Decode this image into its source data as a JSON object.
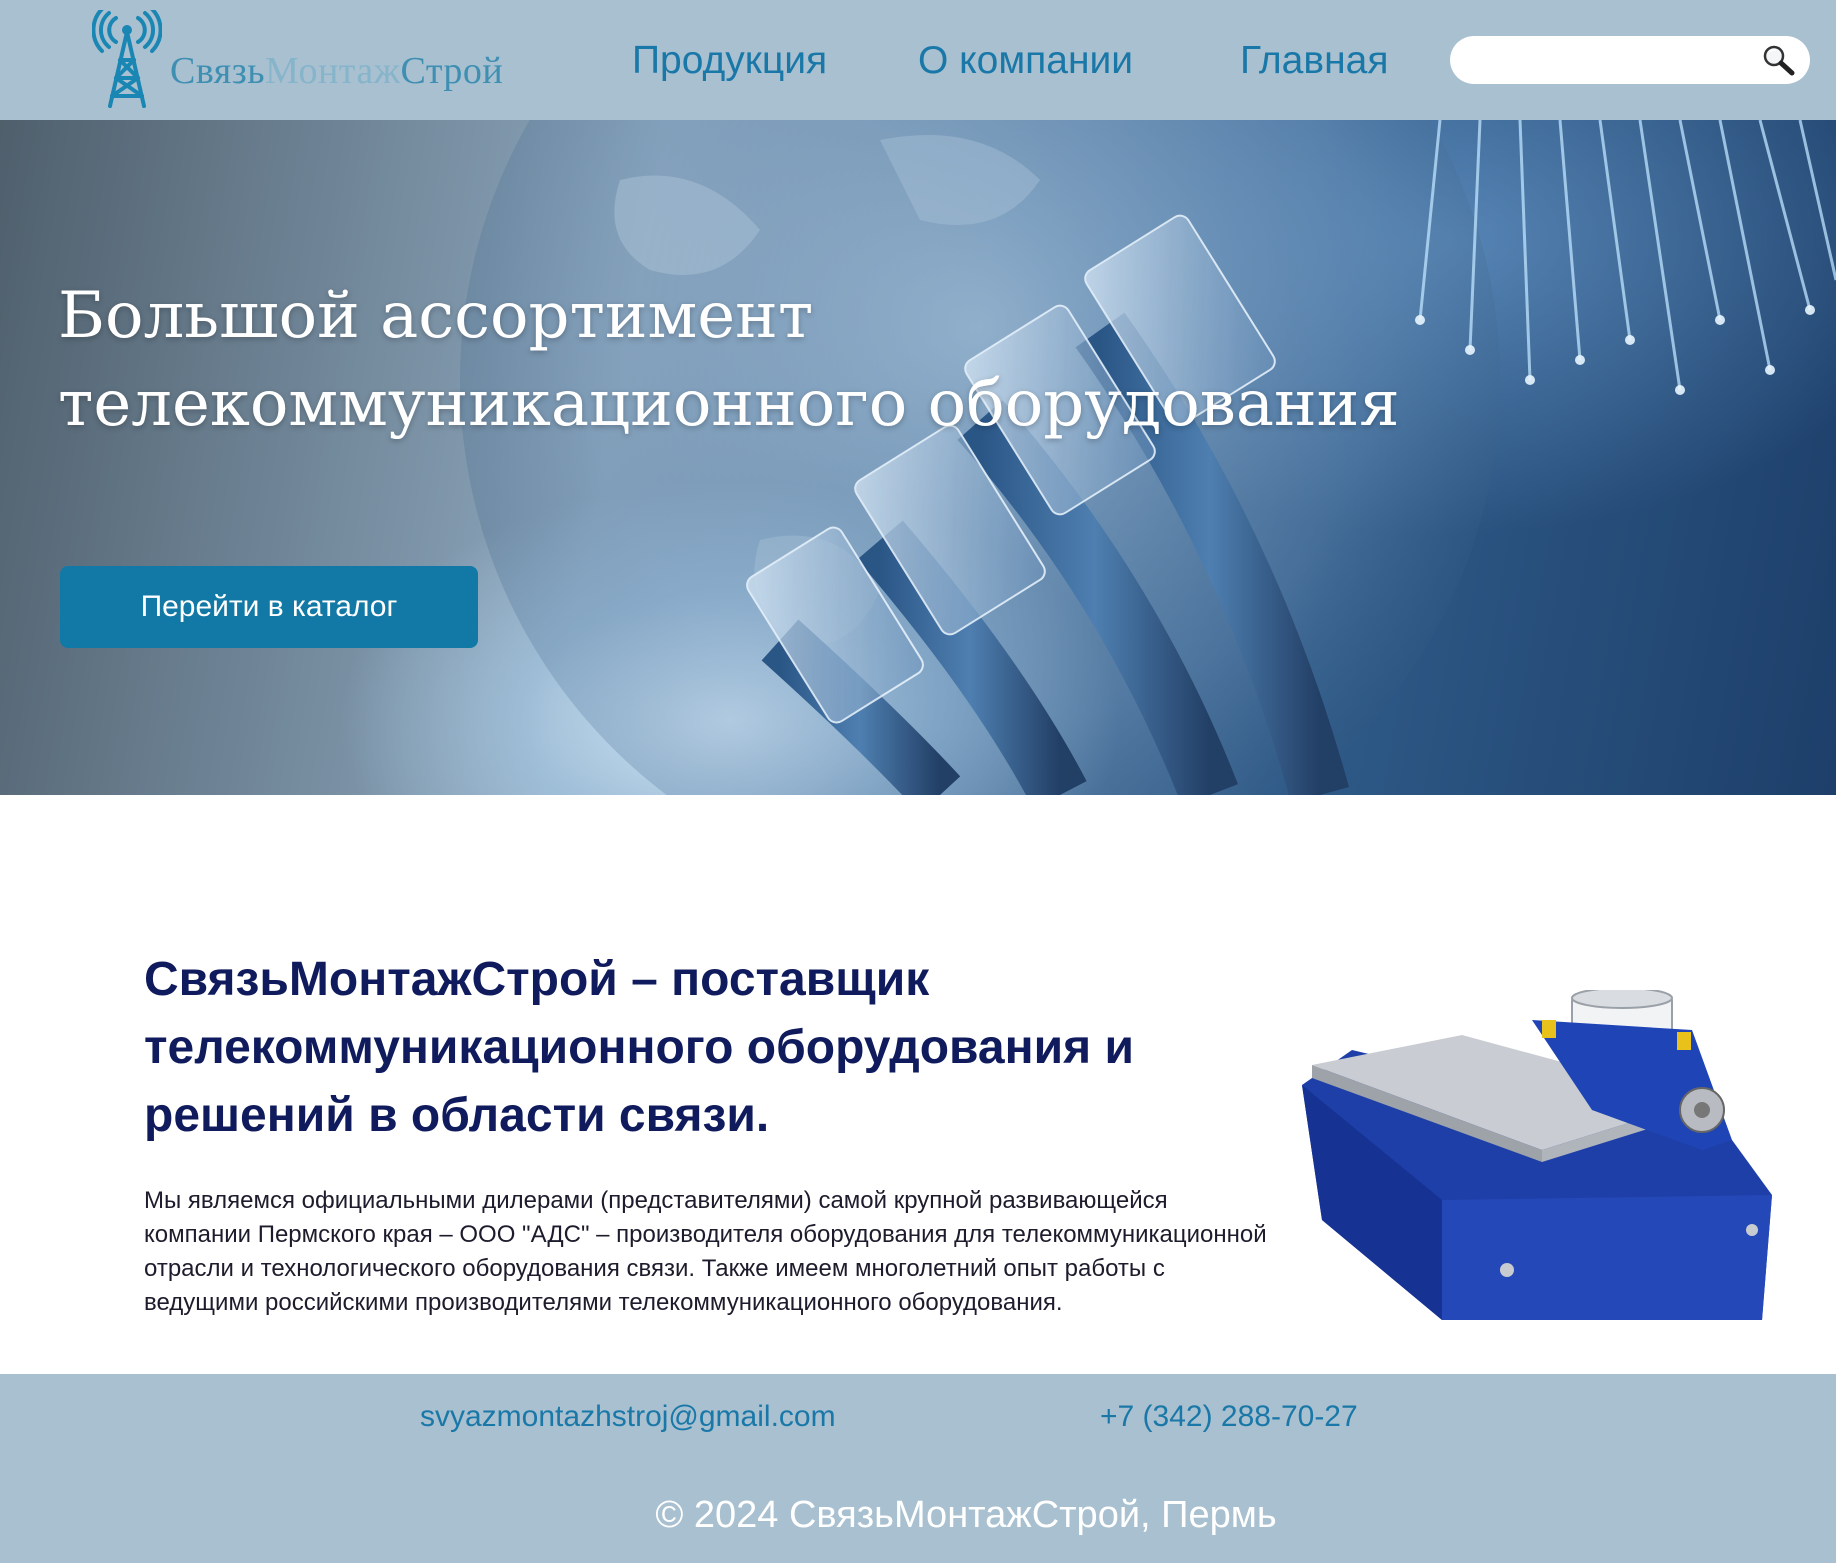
{
  "header": {
    "logo": {
      "part1": "Связь",
      "part2": "Монтаж",
      "part3": "Строй",
      "icon": "radio-tower-icon"
    },
    "nav": [
      {
        "label": "Продукция"
      },
      {
        "label": "О компании"
      },
      {
        "label": "Главная"
      }
    ],
    "search": {
      "placeholder": "",
      "value": "",
      "icon": "search-icon"
    }
  },
  "hero": {
    "title_line1": "Большой ассортимент",
    "title_line2": "телекоммуникационного оборудования",
    "button_label": "Перейти в каталог"
  },
  "about": {
    "title": "СвязьМонтажСтрой – поставщик телекоммуникационного оборудования и решений в области связи.",
    "text": "Мы являемся официальными дилерами (представителями) самой крупной развивающейся компании Пермского края – ООО \"АДС\" – производителя оборудования для телекоммуникационной отрасли и технологического оборудования связи. Также имеем многолетний опыт работы с ведущими российскими производителями телекоммуникационного оборудования."
  },
  "footer": {
    "email": "svyazmontazhstroj@gmail.com",
    "phone": "+7 (342) 288-70-27",
    "copyright": "© 2024 СвязьМонтажСтрой, Пермь"
  },
  "colors": {
    "header_bg": "#a8c0d0",
    "nav_link": "#1a78a8",
    "button_bg": "#1279a6",
    "heading": "#0f1b5c"
  }
}
